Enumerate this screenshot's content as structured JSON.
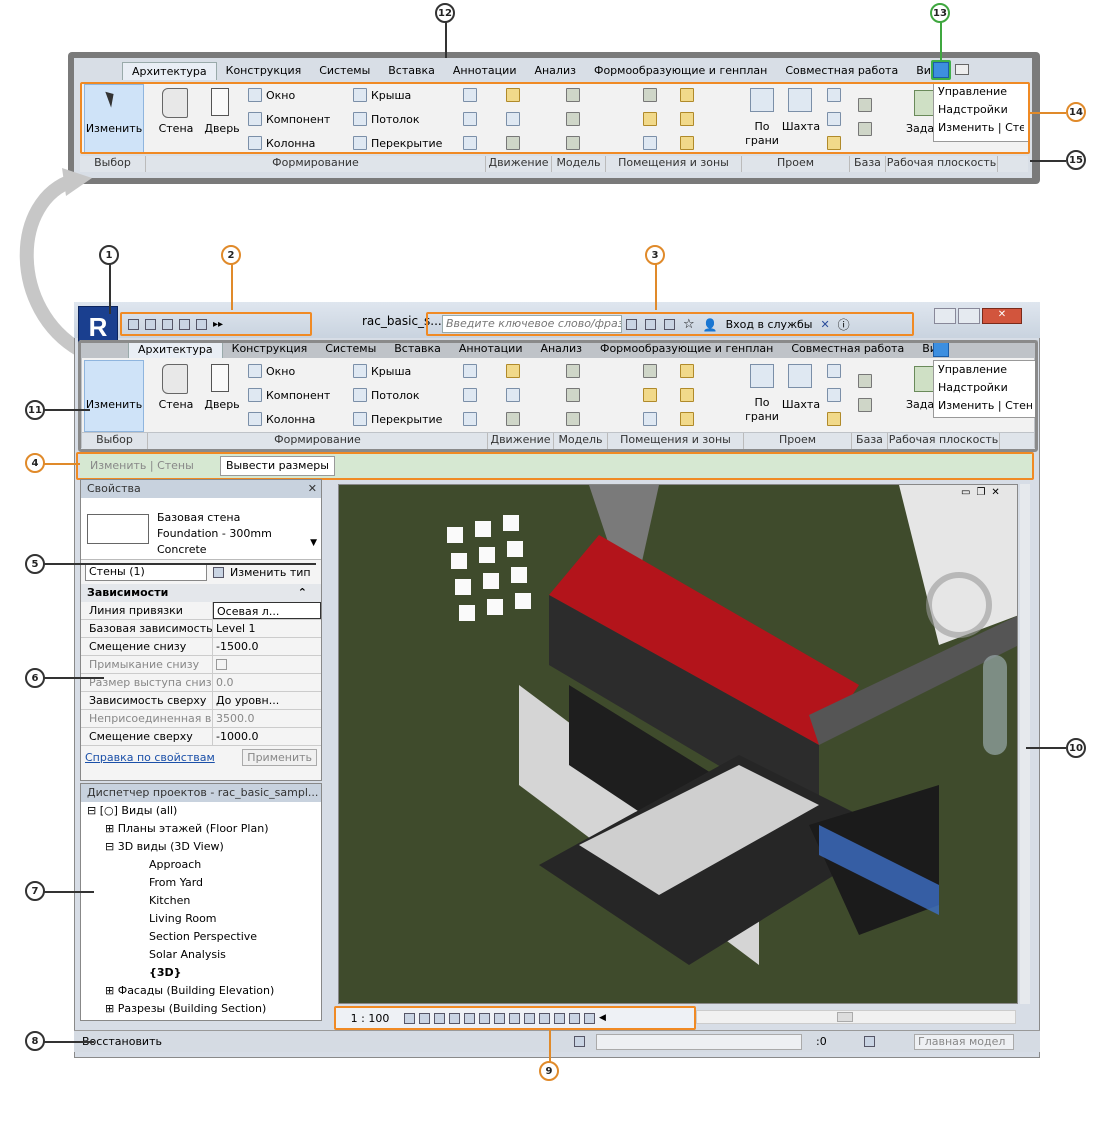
{
  "callouts": [
    "1",
    "2",
    "3",
    "4",
    "5",
    "6",
    "7",
    "8",
    "9",
    "10",
    "11",
    "12",
    "13",
    "14",
    "15"
  ],
  "tabs": [
    "Архитектура",
    "Конструкция",
    "Системы",
    "Вставка",
    "Аннотации",
    "Анализ",
    "Формообразующие и генплан",
    "Совместная работа",
    "Вид"
  ],
  "ribbon": {
    "modify": "Изменить",
    "wall": "Стена",
    "door": "Дверь",
    "window": "Окно",
    "component": "Компонент",
    "column": "Колонна",
    "roof": "Крыша",
    "ceiling": "Потолок",
    "floor": "Перекрытие",
    "by_face_1": "По",
    "by_face_2": "грани",
    "shaft": "Шахта",
    "set": "Зада",
    "panels": [
      "Выбор",
      "Формирование",
      "Движение",
      "Модель",
      "Помещения и зоны",
      "Проем",
      "База",
      "Рабочая плоскость"
    ]
  },
  "overflow_menu": [
    "Управление",
    "Надстройки",
    "Изменить | Стены"
  ],
  "title": {
    "doc": "rac_basic_s...",
    "search_placeholder": "Введите ключевое слово/фразу",
    "signin": "Вход в службы"
  },
  "context_bar": {
    "left": "Изменить | Стены",
    "active": "Вывести размеры"
  },
  "properties": {
    "header": "Свойства",
    "type_line1": "Базовая стена",
    "type_line2": "Foundation - 300mm",
    "type_line3": "Concrete",
    "filter": "Стены (1)",
    "edit_type": "Изменить тип",
    "group": "Зависимости",
    "rows": [
      {
        "k": "Линия привязки",
        "v": "Осевая л..."
      },
      {
        "k": "Базовая зависимость",
        "v": "Level 1"
      },
      {
        "k": "Смещение снизу",
        "v": "-1500.0"
      },
      {
        "k": "Примыкание снизу",
        "v": ""
      },
      {
        "k": "Размер выступа снизу",
        "v": "0.0"
      },
      {
        "k": "Зависимость сверху",
        "v": "До уровн..."
      },
      {
        "k": "Неприсоединенная в...",
        "v": "3500.0"
      },
      {
        "k": "Смещение сверху",
        "v": "-1000.0"
      }
    ],
    "help": "Справка по свойствам",
    "apply": "Применить"
  },
  "project_browser": {
    "header": "Диспетчер проектов - rac_basic_sampl...",
    "items": [
      {
        "label": "Виды (all)",
        "level": 0
      },
      {
        "label": "Планы этажей (Floor Plan)",
        "level": 1
      },
      {
        "label": "3D виды (3D View)",
        "level": 1
      },
      {
        "label": "Approach",
        "level": 2
      },
      {
        "label": "From Yard",
        "level": 2
      },
      {
        "label": "Kitchen",
        "level": 2
      },
      {
        "label": "Living Room",
        "level": 2
      },
      {
        "label": "Section Perspective",
        "level": 2
      },
      {
        "label": "Solar Analysis",
        "level": 2
      },
      {
        "label": "{3D}",
        "level": 2
      },
      {
        "label": "Фасады (Building Elevation)",
        "level": 1
      },
      {
        "label": "Разрезы (Building Section)",
        "level": 1
      }
    ]
  },
  "viewbar": {
    "scale": "1 : 100"
  },
  "status": {
    "text": "Восстановить",
    "zero": ":0",
    "model": "Главная модел"
  }
}
